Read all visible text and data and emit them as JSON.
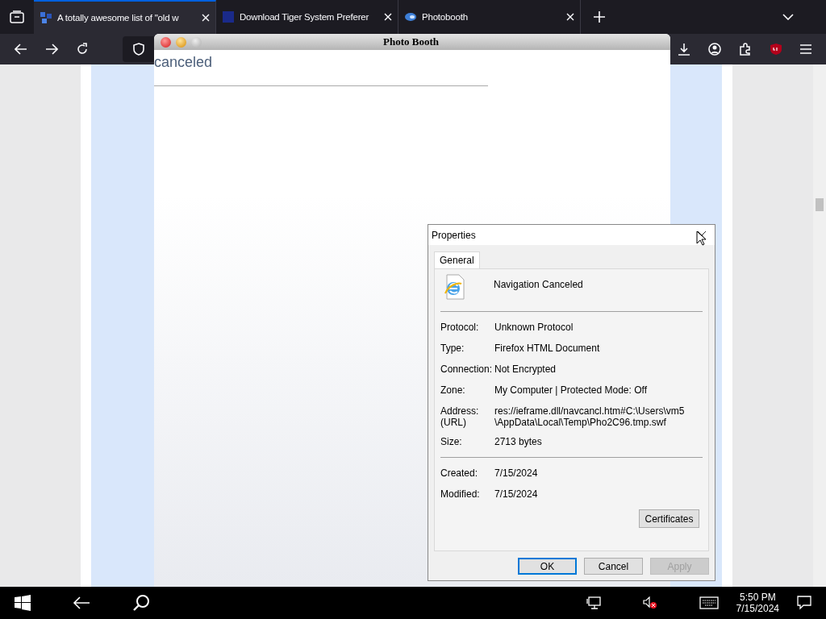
{
  "browser": {
    "tabs": [
      {
        "title": "A totally awesome list of \"old w",
        "selected": true,
        "kind": "squares"
      },
      {
        "title": "Download Tiger System Preferer",
        "selected": false,
        "kind": "square"
      },
      {
        "title": "Photobooth",
        "selected": false,
        "kind": "swoosh"
      }
    ]
  },
  "photo_booth": {
    "title": "Photo Booth",
    "text": "canceled"
  },
  "dialog": {
    "title": "Properties",
    "tabs": [
      {
        "label": "General",
        "selected": true
      }
    ],
    "name": "Navigation Canceled",
    "fields": [
      {
        "label": "Protocol:",
        "value": "Unknown Protocol"
      },
      {
        "label": "Type:",
        "value": "Firefox HTML Document"
      },
      {
        "label": "Connection:",
        "value": "Not Encrypted"
      },
      {
        "label": "Zone:",
        "value": "My Computer | Protected Mode: Off"
      },
      {
        "label": "Address:\n(URL)",
        "value": "res://ieframe.dll/navcancl.htm#C:\\Users\\vm5\n\\AppData\\Local\\Temp\\Pho2C96.tmp.swf"
      },
      {
        "label": "Size:",
        "value": "2713 bytes"
      }
    ],
    "dates": [
      {
        "label": "Created:",
        "value": "7/15/2024"
      },
      {
        "label": "Modified:",
        "value": "7/15/2024"
      }
    ],
    "certificates_button": "Certificates",
    "buttons": [
      {
        "label": "OK",
        "default": true,
        "disabled": false
      },
      {
        "label": "Cancel",
        "default": false,
        "disabled": false
      },
      {
        "label": "Apply",
        "default": false,
        "disabled": true
      }
    ]
  },
  "taskbar": {
    "time": "5:50 PM",
    "date": "7/15/2024"
  }
}
